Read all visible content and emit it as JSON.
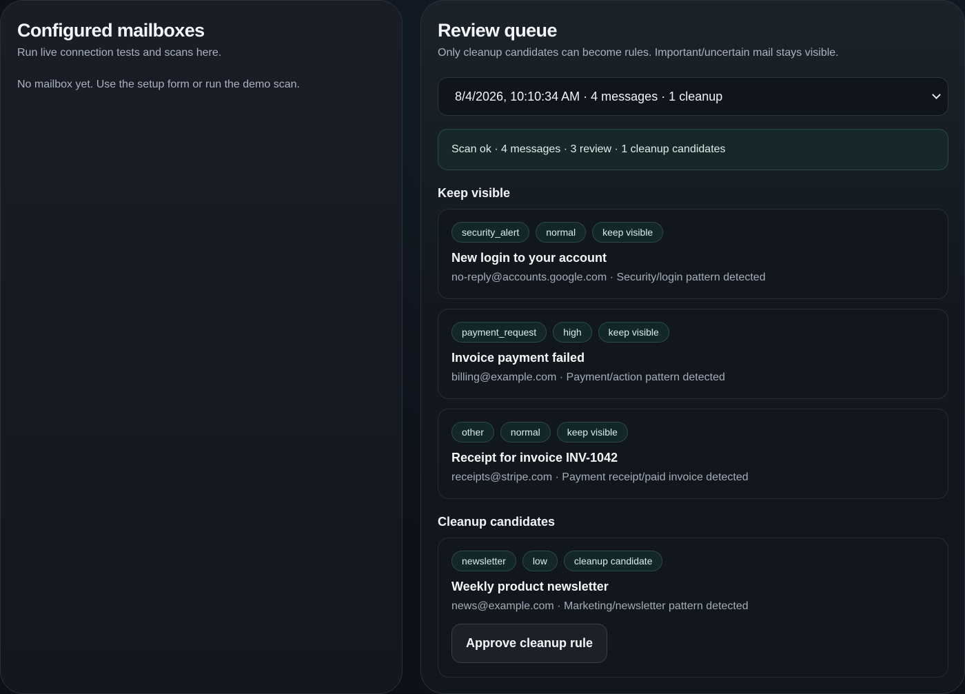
{
  "mailboxes": {
    "title": "Configured mailboxes",
    "subtitle": "Run live connection tests and scans here.",
    "empty_text": "No mailbox yet. Use the setup form or run the demo scan."
  },
  "review": {
    "title": "Review queue",
    "subtitle": "Only cleanup candidates can become rules. Important/uncertain mail stays visible.",
    "scan_select_value": "8/4/2026, 10:10:34 AM · 4 messages · 1 cleanup",
    "status_text": "Scan ok · 4 messages · 3 review · 1 cleanup candidates",
    "keep_visible_heading": "Keep visible",
    "cleanup_heading": "Cleanup candidates",
    "keep_visible_items": [
      {
        "tags": [
          "security_alert",
          "normal",
          "keep visible"
        ],
        "subject": "New login to your account",
        "meta": "no-reply@accounts.google.com · Security/login pattern detected"
      },
      {
        "tags": [
          "payment_request",
          "high",
          "keep visible"
        ],
        "subject": "Invoice payment failed",
        "meta": "billing@example.com · Payment/action pattern detected"
      },
      {
        "tags": [
          "other",
          "normal",
          "keep visible"
        ],
        "subject": "Receipt for invoice INV-1042",
        "meta": "receipts@stripe.com · Payment receipt/paid invoice detected"
      }
    ],
    "cleanup_items": [
      {
        "tags": [
          "newsletter",
          "low",
          "cleanup candidate"
        ],
        "subject": "Weekly product newsletter",
        "meta": "news@example.com · Marketing/newsletter pattern detected",
        "approve_label": "Approve cleanup rule"
      }
    ]
  },
  "icons": {
    "select_chevron": "chevron-down-icon"
  },
  "colors": {
    "background": "#0d1119",
    "panel": "#1a1d26",
    "tag_bg": "#132628",
    "tag_border": "#2b4a4b",
    "status_bg": "#16282a"
  }
}
